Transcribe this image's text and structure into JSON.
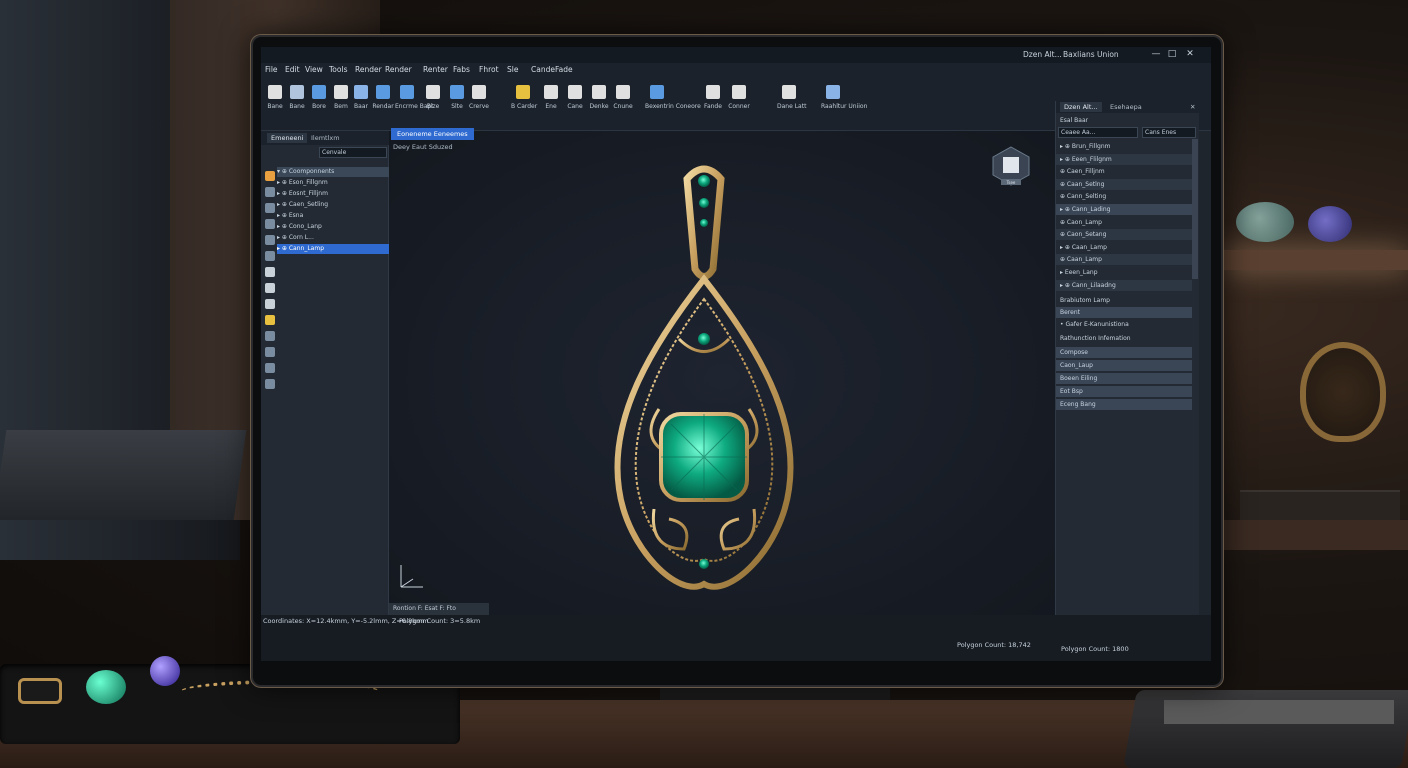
{
  "window": {
    "title_left": "Dzen Alt...",
    "title_user": "Baxlians Union",
    "minimize": "—",
    "maximize": "□",
    "close": "✕"
  },
  "menu": [
    "File",
    "Edit",
    "View",
    "Tools",
    "Render",
    "Render",
    "Renter",
    "Fabs",
    "Fhrot",
    "Sle",
    "Cande",
    "Fade"
  ],
  "ribbon": [
    {
      "icon": "cursor-icon",
      "label": "Bane"
    },
    {
      "icon": "square-icon",
      "label": "Bane"
    },
    {
      "icon": "arrow-icon",
      "label": "Bore"
    },
    {
      "icon": "line-icon",
      "label": "Bem"
    },
    {
      "icon": "doc-icon",
      "label": "Baar"
    },
    {
      "icon": "layers-icon",
      "label": "Rendar"
    },
    {
      "icon": "shape-icon",
      "label": "Encrme Bapt"
    },
    {
      "icon": "pen-icon",
      "label": "Bize"
    },
    {
      "icon": "frame-icon",
      "label": "Slte"
    },
    {
      "icon": "image-icon",
      "label": "Crerve"
    },
    {
      "icon": "pencil-icon",
      "label": "B Carder"
    },
    {
      "icon": "circle-icon",
      "label": "Ene"
    },
    {
      "icon": "square2-icon",
      "label": "Cane"
    },
    {
      "icon": "grid-icon",
      "label": "Denke"
    },
    {
      "icon": "gear-icon",
      "label": "Cnune"
    },
    {
      "icon": "measure-icon",
      "label": "Bexentrin Coneore"
    },
    {
      "icon": "render-icon",
      "label": "Fande"
    },
    {
      "icon": "tools-icon",
      "label": "Conner"
    },
    {
      "icon": "bench-icon",
      "label": "Dane Latt"
    },
    {
      "icon": "book-icon",
      "label": "Raahltur Uniion"
    }
  ],
  "left_panel": {
    "tabs": [
      "Emeneeni",
      "Ilemtlxm"
    ],
    "select": "Cenvale",
    "tree": [
      {
        "label": "▾ ⊕ Coomponnents",
        "type": "hdr"
      },
      {
        "label": "   ▸ ⊕ Eson_Fillgnm",
        "type": ""
      },
      {
        "label": "   ▸ ⊕ Eosnt_Filljnm",
        "type": ""
      },
      {
        "label": "   ▸ ⊕ Caen_Setling",
        "type": ""
      },
      {
        "label": "   ▸ ⊕ Esna",
        "type": ""
      },
      {
        "label": "   ▸ ⊕ Cono_Lanp",
        "type": ""
      },
      {
        "label": "   ▸ ⊕ Corn L...",
        "type": ""
      },
      {
        "label": "▸ ⊕ Cann_Lamp",
        "type": "sel"
      }
    ]
  },
  "viewport": {
    "tab": "Eoneneme Eeneemes",
    "label": "Deey Eaut Sduzed",
    "status": "Rontion  F: Esat  F: Fto",
    "viewcube_label": "Tsee"
  },
  "status": {
    "coordinates": "Coordinates: X=12.4kmm, Y=-5.2lmm, Z=6.8kmm",
    "polygon_left": "Polygon Count: 3=5.8km",
    "polygon_center": "Polygon Count: 18,742",
    "polygon_right": "Polygon Count: 1800"
  },
  "right_panel": {
    "tabs": [
      "Dzen Alt...",
      "Esehaepa"
    ],
    "search": "Esal Baar",
    "select_a": "Ceaee Aa...",
    "select_b": "Cans Enes",
    "rows": [
      {
        "label": "▸ ⊕ Brun_Fillgnm",
        "type": ""
      },
      {
        "label": "▸ ⊕ Eeen_Flilgnm",
        "type": "band"
      },
      {
        "label": "  ⊕ Caen_Filljnm",
        "type": ""
      },
      {
        "label": "  ⊕ Caan_Setlng",
        "type": "band"
      },
      {
        "label": "  ⊕ Cann_Selting",
        "type": ""
      },
      {
        "label": "▸ ⊕ Cann_Lading",
        "type": "band2"
      },
      {
        "label": "  ⊕ Caon_Lamp",
        "type": ""
      },
      {
        "label": "  ⊕ Caon_Setang",
        "type": "band"
      },
      {
        "label": "▸ ⊕ Caan_Lamp",
        "type": ""
      },
      {
        "label": "    ⊕ Caan_Lamp",
        "type": "band"
      },
      {
        "label": "  ▸ Eeen_Lanp",
        "type": ""
      },
      {
        "label": "▸ ⊕ Cann_Lilaadng",
        "type": "band"
      }
    ],
    "section_a": "Brabiutom Lamp",
    "section_a_item": "Berent",
    "section_a_sub": "• Gafer  E-Kanunistiona",
    "section_b": "Rathunction Infemation",
    "section_b_rows": [
      "Compose",
      "Caon_Laup",
      "Boeen Eiling",
      "Eot Bsp",
      "Eceng Bang"
    ]
  },
  "colors": {
    "accent": "#2e6ad0",
    "panel": "#232a33",
    "viewport": "#1a1f28",
    "gold": "#c8a060",
    "emerald": "#0e9a78"
  }
}
